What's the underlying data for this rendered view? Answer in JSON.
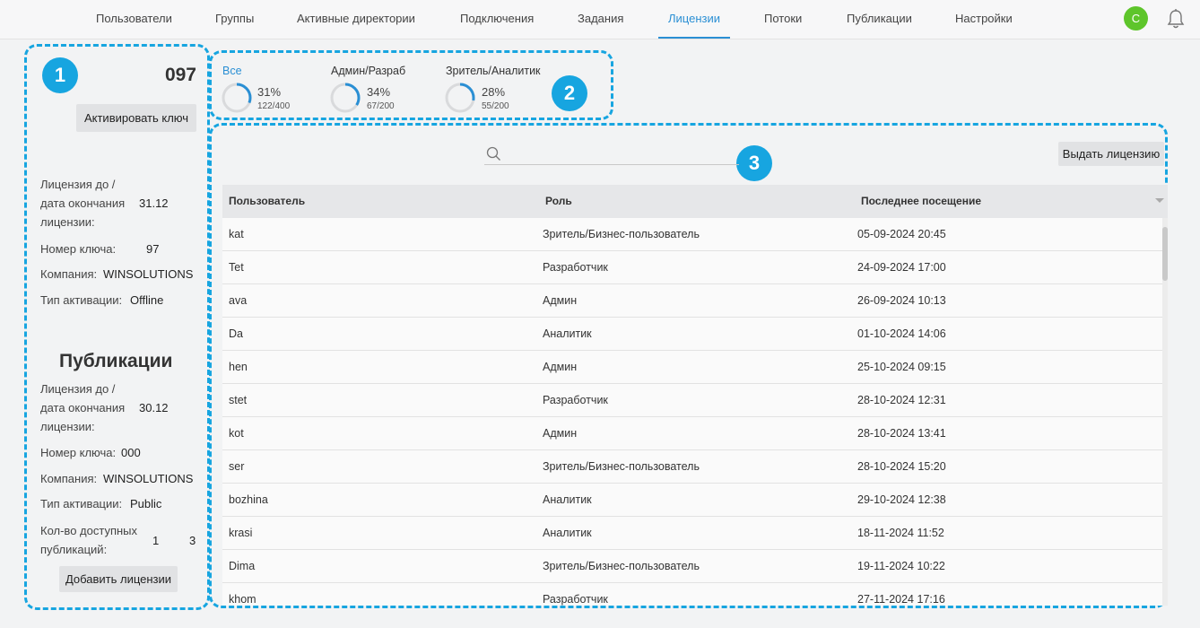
{
  "nav": {
    "items": [
      "Пользователи",
      "Группы",
      "Активные директории",
      "Подключения",
      "Задания",
      "Лицензии",
      "Потоки",
      "Публикации",
      "Настройки"
    ],
    "active_index": 5,
    "avatar_letter": "C"
  },
  "badges": [
    "1",
    "2",
    "3"
  ],
  "license": {
    "key": "097",
    "activate_button": "Активировать ключ",
    "expiry_label": "Лицензия до / дата окончания лицензии:",
    "expiry_value": "31.12",
    "key_number_label": "Номер ключа:",
    "key_number_value": "97",
    "company_label": "Компания:",
    "company_value": "WINSOLUTIONS",
    "activation_label": "Тип активации:",
    "activation_value": "Offline"
  },
  "publications": {
    "title": "Публикации",
    "expiry_label": "Лицензия до / дата окончания лицензии:",
    "expiry_value": "30.12",
    "key_number_label": "Номер ключа:",
    "key_number_value": "000",
    "company_label": "Компания:",
    "company_value": "WINSOLUTIONS",
    "activation_label": "Тип активации:",
    "activation_value": "Public",
    "available_label": "Кол-во доступных публикаций:",
    "available_value_1": "1",
    "available_value_2": "3",
    "add_button": "Добавить лицензии"
  },
  "license_types": [
    {
      "name": "Все",
      "percent": "31%",
      "count": "122/400",
      "fraction": 0.31
    },
    {
      "name": "Админ/Разраб",
      "percent": "34%",
      "count": "67/200",
      "fraction": 0.34
    },
    {
      "name": "Зритель/Аналитик",
      "percent": "28%",
      "count": "55/200",
      "fraction": 0.28
    }
  ],
  "colors": {
    "accent": "#2a8fd4",
    "annotation": "#17a5e0",
    "avatar": "#5ec52b"
  },
  "table": {
    "issue_button": "Выдать лицензию",
    "search_placeholder": "",
    "columns": [
      "Пользователь",
      "Роль",
      "Последнее посещение"
    ],
    "rows": [
      {
        "user": "kat",
        "role": "Зритель/Бизнес-пользователь",
        "last": "05-09-2024 20:45"
      },
      {
        "user": "Tet",
        "role": "Разработчик",
        "last": "24-09-2024 17:00"
      },
      {
        "user": "ava",
        "role": "Админ",
        "last": "26-09-2024 10:13"
      },
      {
        "user": "Da",
        "role": "Аналитик",
        "last": "01-10-2024 14:06"
      },
      {
        "user": "hen",
        "role": "Админ",
        "last": "25-10-2024 09:15"
      },
      {
        "user": "stet",
        "role": "Разработчик",
        "last": "28-10-2024 12:31"
      },
      {
        "user": "kot",
        "role": "Админ",
        "last": "28-10-2024 13:41"
      },
      {
        "user": "ser",
        "role": "Зритель/Бизнес-пользователь",
        "last": "28-10-2024 15:20"
      },
      {
        "user": "bozhina",
        "role": "Аналитик",
        "last": "29-10-2024 12:38"
      },
      {
        "user": "krasi",
        "role": "Аналитик",
        "last": "18-11-2024 11:52"
      },
      {
        "user": "Dima",
        "role": "Зритель/Бизнес-пользователь",
        "last": "19-11-2024 10:22"
      },
      {
        "user": "khom",
        "role": "Разработчик",
        "last": "27-11-2024 17:16"
      }
    ]
  }
}
